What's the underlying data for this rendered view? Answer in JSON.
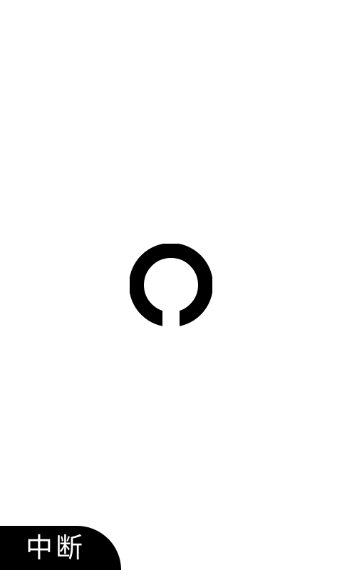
{
  "loading": {
    "icon": "loading-ring-icon",
    "color": "#000000"
  },
  "abort_button": {
    "label": "中断",
    "background": "#000000",
    "text_color": "#ffffff"
  }
}
